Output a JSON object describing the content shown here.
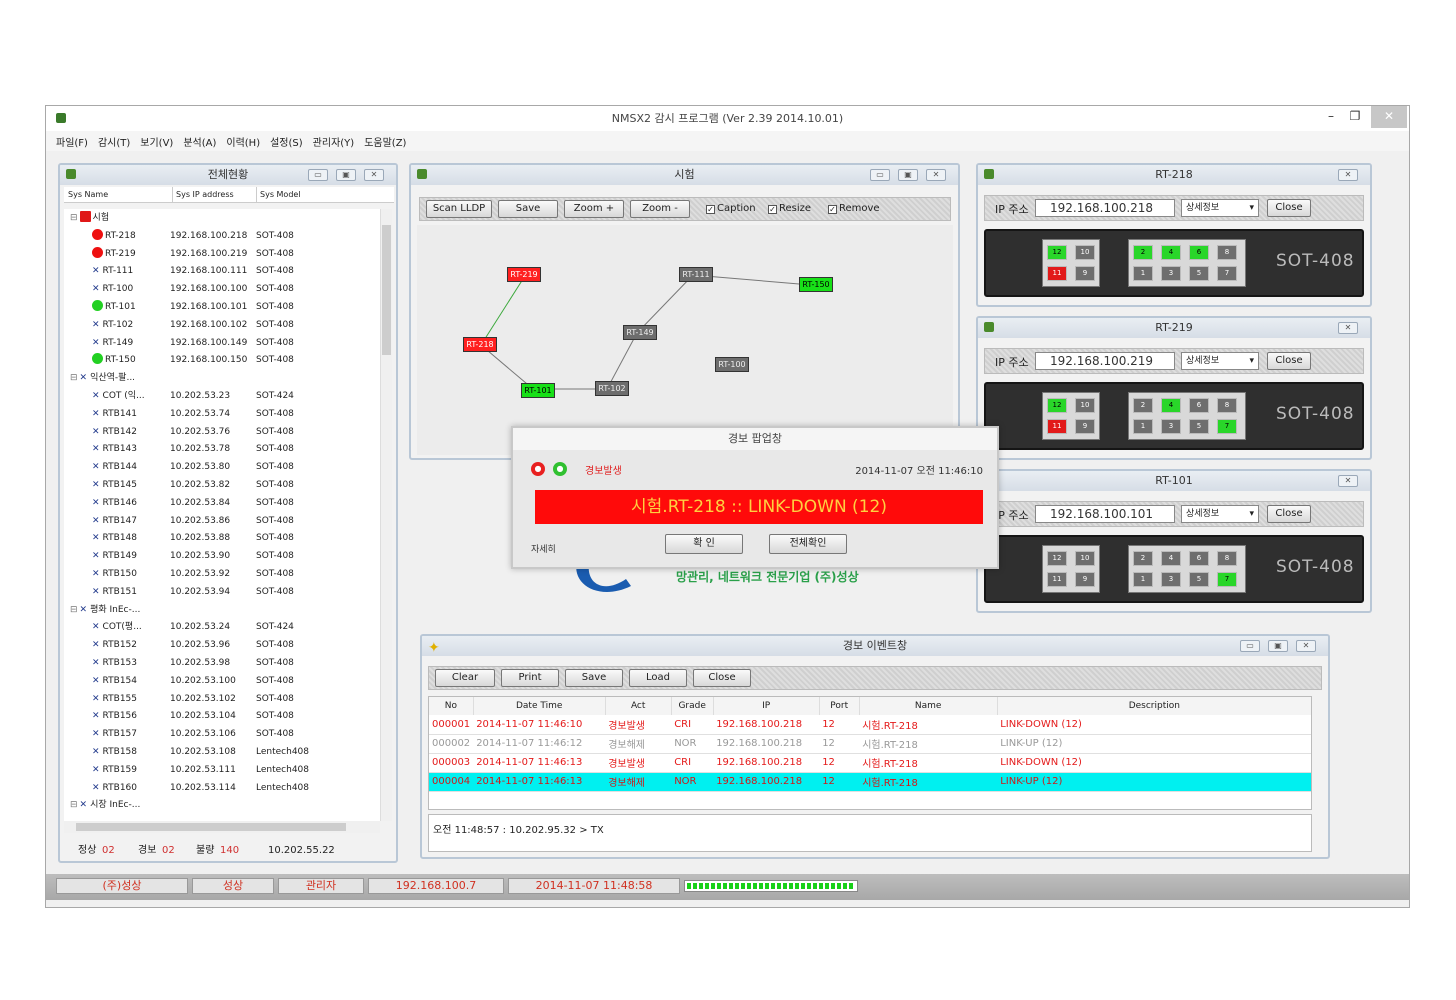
{
  "window": {
    "title": "NMSX2 감시 프로그램 (Ver 2.39  2014.10.01)",
    "minimize": "–",
    "maximize": "❐",
    "close": "✕"
  },
  "menu": [
    "파일(F)",
    "감시(T)",
    "보기(V)",
    "분석(A)",
    "이력(H)",
    "설정(S)",
    "관리자(Y)",
    "도움말(Z)"
  ],
  "overview": {
    "title": "전체현황",
    "headers": [
      "Sys Name",
      "Sys IP address",
      "Sys Model"
    ],
    "rows": [
      {
        "name": "시험",
        "ip": "",
        "model": "",
        "icon": "red-square",
        "level": 1
      },
      {
        "name": "RT-218",
        "ip": "192.168.100.218",
        "model": "SOT-408",
        "icon": "red-dot",
        "level": 2
      },
      {
        "name": "RT-219",
        "ip": "192.168.100.219",
        "model": "SOT-408",
        "icon": "red-dot",
        "level": 2
      },
      {
        "name": "RT-111",
        "ip": "192.168.100.111",
        "model": "SOT-408",
        "icon": "x",
        "level": 2
      },
      {
        "name": "RT-100",
        "ip": "192.168.100.100",
        "model": "SOT-408",
        "icon": "x",
        "level": 2
      },
      {
        "name": "RT-101",
        "ip": "192.168.100.101",
        "model": "SOT-408",
        "icon": "green-dot",
        "level": 2
      },
      {
        "name": "RT-102",
        "ip": "192.168.100.102",
        "model": "SOT-408",
        "icon": "x",
        "level": 2
      },
      {
        "name": "RT-149",
        "ip": "192.168.100.149",
        "model": "SOT-408",
        "icon": "x",
        "level": 2
      },
      {
        "name": "RT-150",
        "ip": "192.168.100.150",
        "model": "SOT-408",
        "icon": "green-dot",
        "level": 2
      },
      {
        "name": "익산역-팔...",
        "ip": "",
        "model": "",
        "icon": "x",
        "level": 1
      },
      {
        "name": "COT (익...",
        "ip": "10.202.53.23",
        "model": "SOT-424",
        "icon": "x",
        "level": 2
      },
      {
        "name": "RTB141",
        "ip": "10.202.53.74",
        "model": "SOT-408",
        "icon": "x",
        "level": 2
      },
      {
        "name": "RTB142",
        "ip": "10.202.53.76",
        "model": "SOT-408",
        "icon": "x",
        "level": 2
      },
      {
        "name": "RTB143",
        "ip": "10.202.53.78",
        "model": "SOT-408",
        "icon": "x",
        "level": 2
      },
      {
        "name": "RTB144",
        "ip": "10.202.53.80",
        "model": "SOT-408",
        "icon": "x",
        "level": 2
      },
      {
        "name": "RTB145",
        "ip": "10.202.53.82",
        "model": "SOT-408",
        "icon": "x",
        "level": 2
      },
      {
        "name": "RTB146",
        "ip": "10.202.53.84",
        "model": "SOT-408",
        "icon": "x",
        "level": 2
      },
      {
        "name": "RTB147",
        "ip": "10.202.53.86",
        "model": "SOT-408",
        "icon": "x",
        "level": 2
      },
      {
        "name": "RTB148",
        "ip": "10.202.53.88",
        "model": "SOT-408",
        "icon": "x",
        "level": 2
      },
      {
        "name": "RTB149",
        "ip": "10.202.53.90",
        "model": "SOT-408",
        "icon": "x",
        "level": 2
      },
      {
        "name": "RTB150",
        "ip": "10.202.53.92",
        "model": "SOT-408",
        "icon": "x",
        "level": 2
      },
      {
        "name": "RTB151",
        "ip": "10.202.53.94",
        "model": "SOT-408",
        "icon": "x",
        "level": 2
      },
      {
        "name": "평화 InEc-...",
        "ip": "",
        "model": "",
        "icon": "x",
        "level": 1
      },
      {
        "name": "COT(평...",
        "ip": "10.202.53.24",
        "model": "SOT-424",
        "icon": "x",
        "level": 2
      },
      {
        "name": "RTB152",
        "ip": "10.202.53.96",
        "model": "SOT-408",
        "icon": "x",
        "level": 2
      },
      {
        "name": "RTB153",
        "ip": "10.202.53.98",
        "model": "SOT-408",
        "icon": "x",
        "level": 2
      },
      {
        "name": "RTB154",
        "ip": "10.202.53.100",
        "model": "SOT-408",
        "icon": "x",
        "level": 2
      },
      {
        "name": "RTB155",
        "ip": "10.202.53.102",
        "model": "SOT-408",
        "icon": "x",
        "level": 2
      },
      {
        "name": "RTB156",
        "ip": "10.202.53.104",
        "model": "SOT-408",
        "icon": "x",
        "level": 2
      },
      {
        "name": "RTB157",
        "ip": "10.202.53.106",
        "model": "SOT-408",
        "icon": "x",
        "level": 2
      },
      {
        "name": "RTB158",
        "ip": "10.202.53.108",
        "model": "Lentech408",
        "icon": "x",
        "level": 2
      },
      {
        "name": "RTB159",
        "ip": "10.202.53.111",
        "model": "Lentech408",
        "icon": "x",
        "level": 2
      },
      {
        "name": "RTB160",
        "ip": "10.202.53.114",
        "model": "Lentech408",
        "icon": "x",
        "level": 2
      },
      {
        "name": "시장 InEc-...",
        "ip": "",
        "model": "",
        "icon": "x",
        "level": 1
      }
    ],
    "status": {
      "normal_label": "정상",
      "normal_count": "02",
      "alarm_label": "경보",
      "alarm_count": "02",
      "bad_label": "불량",
      "bad_count": "140",
      "ip": "10.202.55.22"
    }
  },
  "topology": {
    "title": "시험",
    "buttons": [
      "Scan LLDP",
      "Save",
      "Zoom +",
      "Zoom -"
    ],
    "checks": [
      "Caption",
      "Resize",
      "Remove"
    ],
    "nodes": [
      {
        "id": "RT-219",
        "state": "red"
      },
      {
        "id": "RT-218",
        "state": "red"
      },
      {
        "id": "RT-101",
        "state": "green"
      },
      {
        "id": "RT-102",
        "state": "gray"
      },
      {
        "id": "RT-149",
        "state": "gray"
      },
      {
        "id": "RT-111",
        "state": "gray"
      },
      {
        "id": "RT-150",
        "state": "green"
      },
      {
        "id": "RT-100",
        "state": "gray"
      }
    ]
  },
  "logo": {
    "text": "망관리, 네트워크 전문기업 (주)성상"
  },
  "popup": {
    "title": "경보 팝업창",
    "kind": "경보발생",
    "time": "2014-11-07 오전 11:46:10",
    "message": "시험.RT-218 :: LINK-DOWN (12)",
    "left_label": "자세히",
    "ok": "확 인",
    "all_ok": "전체확인"
  },
  "devices": [
    {
      "title": "RT-218",
      "ip_label": "IP 주소",
      "ip": "192.168.100.218",
      "detail": "상세정보",
      "close": "Close",
      "model": "SOT-408",
      "left_top": [
        [
          "12",
          "g"
        ],
        [
          "10",
          "y"
        ]
      ],
      "left_bot": [
        [
          "11",
          "r"
        ],
        [
          "9",
          "y"
        ]
      ],
      "right_top": [
        [
          "2",
          "g"
        ],
        [
          "4",
          "g"
        ],
        [
          "6",
          "g"
        ],
        [
          "8",
          "y"
        ]
      ],
      "right_bot": [
        [
          "1",
          "y"
        ],
        [
          "3",
          "y"
        ],
        [
          "5",
          "y"
        ],
        [
          "7",
          "y"
        ]
      ]
    },
    {
      "title": "RT-219",
      "ip_label": "IP 주소",
      "ip": "192.168.100.219",
      "detail": "상세정보",
      "close": "Close",
      "model": "SOT-408",
      "left_top": [
        [
          "12",
          "g"
        ],
        [
          "10",
          "y"
        ]
      ],
      "left_bot": [
        [
          "11",
          "r"
        ],
        [
          "9",
          "y"
        ]
      ],
      "right_top": [
        [
          "2",
          "y"
        ],
        [
          "4",
          "g"
        ],
        [
          "6",
          "y"
        ],
        [
          "8",
          "y"
        ]
      ],
      "right_bot": [
        [
          "1",
          "y"
        ],
        [
          "3",
          "y"
        ],
        [
          "5",
          "y"
        ],
        [
          "7",
          "g"
        ]
      ]
    },
    {
      "title": "RT-101",
      "ip_label": "IP 주소",
      "ip": "192.168.100.101",
      "detail": "상세정보",
      "close": "Close",
      "model": "SOT-408",
      "left_top": [
        [
          "12",
          "y"
        ],
        [
          "10",
          "y"
        ]
      ],
      "left_bot": [
        [
          "11",
          "y"
        ],
        [
          "9",
          "y"
        ]
      ],
      "right_top": [
        [
          "2",
          "y"
        ],
        [
          "4",
          "y"
        ],
        [
          "6",
          "y"
        ],
        [
          "8",
          "y"
        ]
      ],
      "right_bot": [
        [
          "1",
          "y"
        ],
        [
          "3",
          "y"
        ],
        [
          "5",
          "y"
        ],
        [
          "7",
          "g"
        ]
      ]
    }
  ],
  "events": {
    "title": "경보 이벤트창",
    "buttons": [
      "Clear",
      "Print",
      "Save",
      "Load",
      "Close"
    ],
    "headers": [
      "No",
      "Date Time",
      "Act",
      "Grade",
      "IP",
      "Port",
      "Name",
      "Description"
    ],
    "rows": [
      {
        "no": "000001",
        "time": "2014-11-07 11:46:10",
        "act": "경보발생",
        "grade": "CRI",
        "ip": "192.168.100.218",
        "port": "12",
        "name": "시험.RT-218",
        "desc": "LINK-DOWN (12)",
        "style": "red"
      },
      {
        "no": "000002",
        "time": "2014-11-07 11:46:12",
        "act": "경보해제",
        "grade": "NOR",
        "ip": "192.168.100.218",
        "port": "12",
        "name": "시험.RT-218",
        "desc": "LINK-UP (12)",
        "style": "gray"
      },
      {
        "no": "000003",
        "time": "2014-11-07 11:46:13",
        "act": "경보발생",
        "grade": "CRI",
        "ip": "192.168.100.218",
        "port": "12",
        "name": "시험.RT-218",
        "desc": "LINK-DOWN (12)",
        "style": "red"
      },
      {
        "no": "000004",
        "time": "2014-11-07 11:46:13",
        "act": "경보해제",
        "grade": "NOR",
        "ip": "192.168.100.218",
        "port": "12",
        "name": "시험.RT-218",
        "desc": "LINK-UP (12)",
        "style": "hl"
      }
    ],
    "log": "오전 11:48:57 : 10.202.95.32 > TX"
  },
  "statusbar": [
    "(주)성상",
    "성상",
    "관리자",
    "192.168.100.7",
    "2014-11-07 11:48:58"
  ]
}
